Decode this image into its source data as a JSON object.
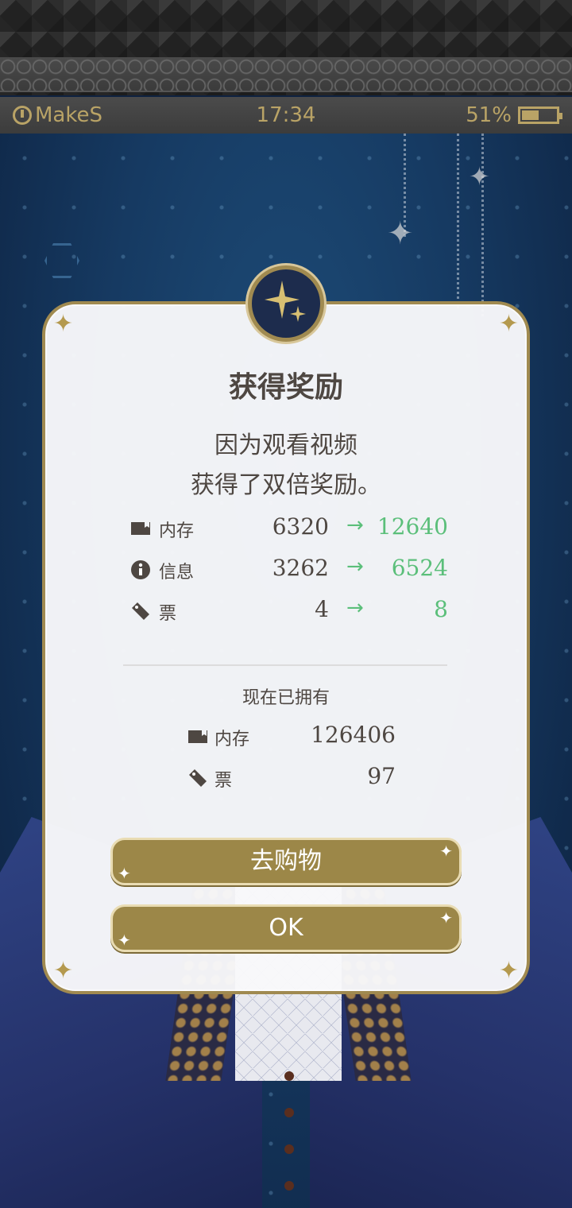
{
  "status_bar": {
    "app_name": "MakeS",
    "time": "17:34",
    "battery_percent": "51%",
    "battery_level": 0.51
  },
  "dialog": {
    "title": "获得奖励",
    "message_line1": "因为观看视频",
    "message_line2": "获得了双倍奖励。",
    "rewards": [
      {
        "label": "内存",
        "icon": "memory-card-icon",
        "before": "6320",
        "arrow": "→",
        "after": "12640"
      },
      {
        "label": "信息",
        "icon": "info-icon",
        "before": "3262",
        "arrow": "→",
        "after": "6524"
      },
      {
        "label": "票",
        "icon": "ticket-icon",
        "before": "4",
        "arrow": "→",
        "after": "8"
      }
    ],
    "owned_title": "现在已拥有",
    "owned": [
      {
        "label": "内存",
        "icon": "memory-card-icon",
        "value": "126406"
      },
      {
        "label": "票",
        "icon": "ticket-icon",
        "value": "97"
      }
    ],
    "shop_button": "去购物",
    "ok_button": "OK"
  },
  "colors": {
    "accent_gold": "#9c8748",
    "increase_green": "#5bbf7a",
    "text_dark": "#4e4742",
    "medallion_navy": "#1d2c4d"
  }
}
